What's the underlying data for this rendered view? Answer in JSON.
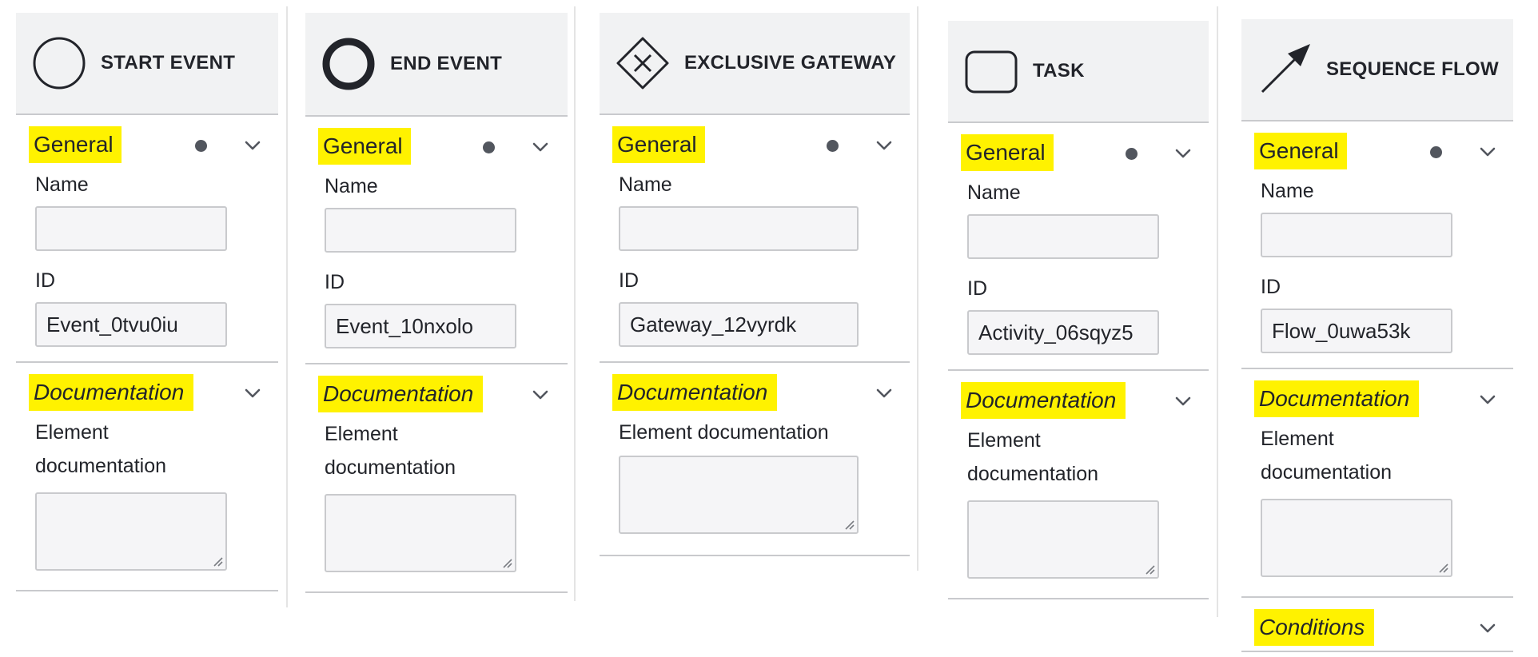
{
  "labels": {
    "general": "General",
    "name": "Name",
    "id": "ID",
    "documentation": "Documentation",
    "element_doc_line1": "Element",
    "element_doc_line2": "documentation",
    "element_doc_full": "Element documentation",
    "conditions": "Conditions"
  },
  "panels": [
    {
      "title": "START EVENT",
      "icon": "start-event-icon",
      "name_value": "",
      "id_value": "Event_0tvu0iu"
    },
    {
      "title": "END EVENT",
      "icon": "end-event-icon",
      "name_value": "",
      "id_value": "Event_10nxolo"
    },
    {
      "title": "EXCLUSIVE GATEWAY",
      "icon": "exclusive-gateway-icon",
      "name_value": "",
      "id_value": "Gateway_12vyrdk"
    },
    {
      "title": "TASK",
      "icon": "task-icon",
      "name_value": "",
      "id_value": "Activity_06sqyz5"
    },
    {
      "title": "SEQUENCE FLOW",
      "icon": "sequence-flow-icon",
      "name_value": "",
      "id_value": "Flow_0uwa53k"
    }
  ],
  "colors": {
    "highlight": "#fff200",
    "header_bg": "#f1f2f3",
    "border": "#c9cacd",
    "dot": "#52565e"
  }
}
